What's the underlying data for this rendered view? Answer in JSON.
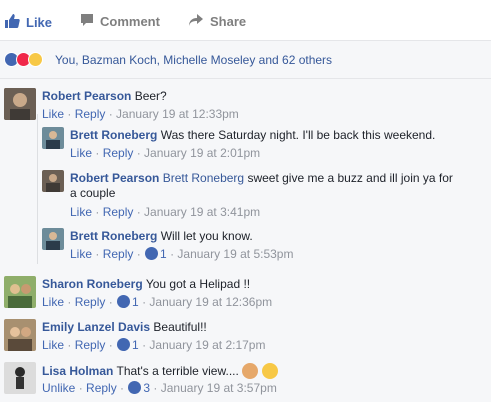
{
  "actions": {
    "like": "Like",
    "comment": "Comment",
    "share": "Share"
  },
  "reactions": {
    "text": "You, Bazman Koch, Michelle Moseley and 62 others"
  },
  "comments": [
    {
      "name": "Robert Pearson",
      "text": "Beer?",
      "like": "Like",
      "reply": "Reply",
      "time": "January 19 at 12:33pm"
    },
    {
      "name": "Brett Roneberg",
      "text": "Was there Saturday night. I'll be back this weekend.",
      "like": "Like",
      "reply": "Reply",
      "time": "January 19 at 2:01pm"
    },
    {
      "name": "Robert Pearson",
      "mention": "Brett Roneberg",
      "text": "sweet give me a buzz and ill join ya for",
      "text2": "a couple",
      "like": "Like",
      "reply": "Reply",
      "time": "January 19 at 3:41pm"
    },
    {
      "name": "Brett Roneberg",
      "text": "Will let you know.",
      "like": "Like",
      "reply": "Reply",
      "likes": "1",
      "time": "January 19 at 5:53pm"
    },
    {
      "name": "Sharon Roneberg",
      "text": "You got a Helipad !!",
      "like": "Like",
      "reply": "Reply",
      "likes": "1",
      "time": "January 19 at 12:36pm"
    },
    {
      "name": "Emily Lanzel Davis",
      "text": "Beautiful!!",
      "like": "Like",
      "reply": "Reply",
      "likes": "1",
      "time": "January 19 at 2:17pm"
    },
    {
      "name": "Lisa Holman",
      "text": "That's a terrible view....",
      "like": "Unlike",
      "reply": "Reply",
      "likes": "3",
      "time": "January 19 at 3:57pm"
    }
  ],
  "icons": {
    "like": "thumbs-up-icon",
    "comment": "speech-bubble-icon",
    "share": "share-arrow-icon"
  },
  "colors": {
    "brand": "#4267b2",
    "link": "#365899",
    "meta": "#90949c",
    "bg": "#f6f7f9"
  }
}
